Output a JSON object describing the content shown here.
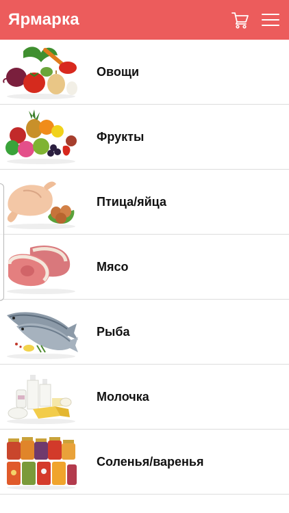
{
  "header": {
    "title": "Ярмарка",
    "cart_icon": "cart-icon",
    "menu_icon": "hamburger-menu-icon"
  },
  "colors": {
    "header_bg": "#ec5c5c",
    "header_text": "#ffffff",
    "row_text": "#111111",
    "divider": "#dcdcdc"
  },
  "categories": [
    {
      "label": "Овощи",
      "image": "vegetables-image"
    },
    {
      "label": "Фрукты",
      "image": "fruits-image"
    },
    {
      "label": "Птица/яйца",
      "image": "poultry-eggs-image"
    },
    {
      "label": "Мясо",
      "image": "meat-image"
    },
    {
      "label": "Рыба",
      "image": "fish-image"
    },
    {
      "label": "Молочка",
      "image": "dairy-image"
    },
    {
      "label": "Соленья/варенья",
      "image": "preserves-image"
    }
  ]
}
